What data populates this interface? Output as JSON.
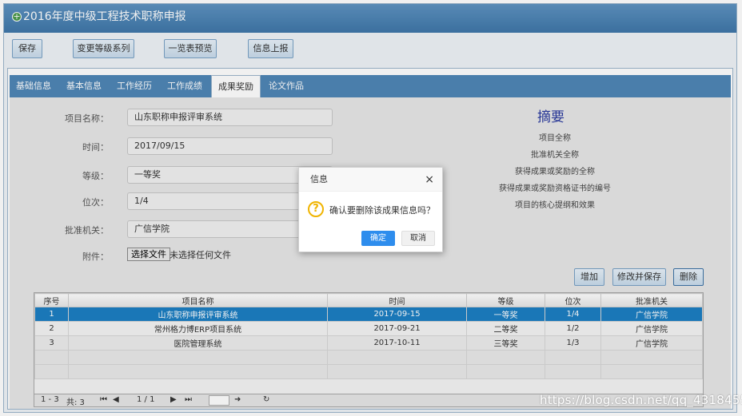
{
  "window": {
    "title": "2016年度中级工程技术职称申报",
    "title_icon": "plus-circle-icon"
  },
  "toolbar": {
    "buttons": [
      "保存",
      "变更等级系列",
      "一览表预览",
      "信息上报"
    ]
  },
  "tabs": [
    "基础信息",
    "基本信息",
    "工作经历",
    "工作成绩",
    "成果奖励",
    "论文作品"
  ],
  "active_tab": "成果奖励",
  "form": {
    "project_name_label": "项目名称：",
    "project_name_value": "山东职称申报评审系统",
    "time_label": "时间：",
    "time_value": "2017/09/15",
    "level_label": "等级：",
    "level_value": "一等奖",
    "rank_label": "位次：",
    "rank_value": "1/4",
    "authority_label": "批准机关：",
    "authority_value": "广信学院",
    "attachment_label": "附件：",
    "file_button": "选择文件",
    "file_status": "未选择任何文件"
  },
  "summary": {
    "title": "摘要",
    "lines": [
      "项目全称",
      "批准机关全称",
      "获得成果或奖励的全称",
      "获得成果或奖励资格证书的编号",
      "项目的核心提纲和效果"
    ]
  },
  "actions": {
    "add": "增加",
    "modify_save": "修改并保存",
    "delete": "删除"
  },
  "table": {
    "headers": [
      "序号",
      "项目名称",
      "时间",
      "等级",
      "位次",
      "批准机关"
    ],
    "rows": [
      [
        "1",
        "山东职称申报评审系统",
        "2017-09-15",
        "一等奖",
        "1/4",
        "广信学院"
      ],
      [
        "2",
        "常州格力博ERP项目系统",
        "2017-09-21",
        "二等奖",
        "1/2",
        "广信学院"
      ],
      [
        "3",
        "医院管理系统",
        "2017-10-11",
        "三等奖",
        "1/3",
        "广信学院"
      ]
    ],
    "selected_row": 0
  },
  "pager": {
    "range": "1 - 3",
    "total": "共: 3",
    "page": "1 / 1"
  },
  "dialog": {
    "title": "信息",
    "message": "确认要删除该成果信息吗？",
    "ok": "确定",
    "cancel": "取消",
    "icon": "question-icon",
    "close": "×"
  },
  "watermark": "https://blog.csdn.net/qq_43184550",
  "colors": {
    "titlebar": "#4f86b6",
    "tabbar": "#4f86b6",
    "selected_row": "#1c7fc3",
    "ok_button": "#2e8ded",
    "question_icon": "#f0b400"
  }
}
